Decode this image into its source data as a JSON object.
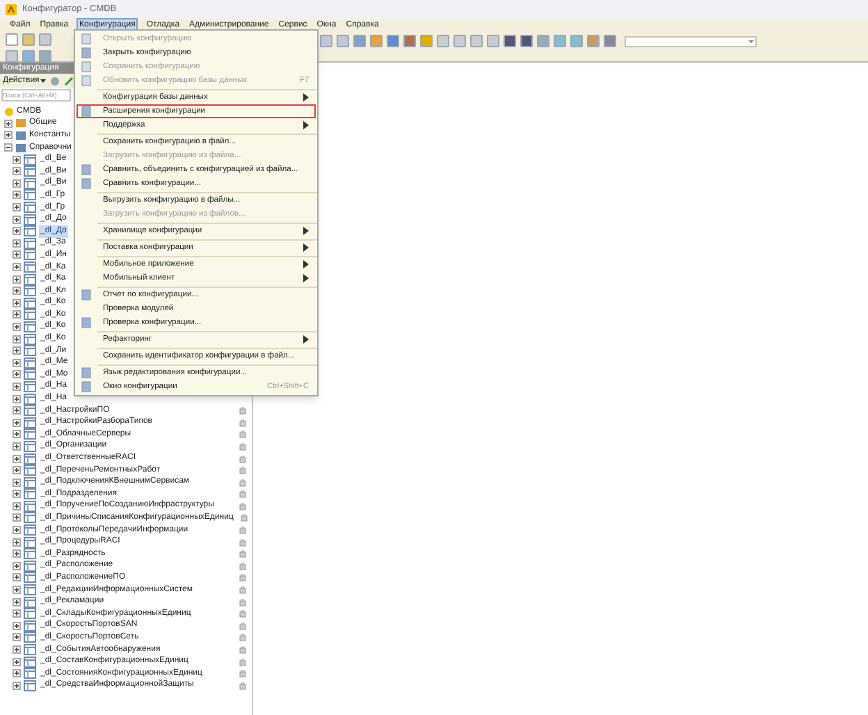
{
  "window": {
    "title": "Конфигуратор - CMDB"
  },
  "menubar": [
    {
      "label": "Файл",
      "selected": false
    },
    {
      "label": "Правка",
      "selected": false
    },
    {
      "label": "Конфигурация",
      "selected": true
    },
    {
      "label": "Отладка",
      "selected": false
    },
    {
      "label": "Администрирование",
      "selected": false
    },
    {
      "label": "Сервис",
      "selected": false
    },
    {
      "label": "Окна",
      "selected": false
    },
    {
      "label": "Справка",
      "selected": false
    }
  ],
  "menu": [
    {
      "kind": "item",
      "label": "Открыть конфигурацию",
      "disabled": true,
      "icon": true
    },
    {
      "kind": "item",
      "label": "Закрыть конфигурацию",
      "disabled": false,
      "icon": true
    },
    {
      "kind": "item",
      "label": "Сохранить конфигурацию",
      "disabled": true,
      "icon": true
    },
    {
      "kind": "item",
      "label": "Обновить конфигурацию базы данных",
      "disabled": true,
      "icon": true,
      "shortcut": "F7"
    },
    {
      "kind": "separator"
    },
    {
      "kind": "item",
      "label": "Конфигурация базы данных",
      "disabled": false,
      "submenu": true
    },
    {
      "kind": "item",
      "label": "Расширения конфигурации",
      "disabled": false,
      "icon": true,
      "outlined": true
    },
    {
      "kind": "item",
      "label": "Поддержка",
      "disabled": false,
      "submenu": true
    },
    {
      "kind": "separator"
    },
    {
      "kind": "item",
      "label": "Сохранить конфигурацию в файл...",
      "disabled": false
    },
    {
      "kind": "item",
      "label": "Загрузить конфигурацию из файла...",
      "disabled": true
    },
    {
      "kind": "item",
      "label": "Сравнить, объединить с конфигурацией из файла...",
      "disabled": false,
      "icon": true
    },
    {
      "kind": "item",
      "label": "Сравнить конфигурации...",
      "disabled": false,
      "icon": true
    },
    {
      "kind": "separator"
    },
    {
      "kind": "item",
      "label": "Выгрузить конфигурацию в файлы...",
      "disabled": false
    },
    {
      "kind": "item",
      "label": "Загрузить конфигурацию из файлов...",
      "disabled": true
    },
    {
      "kind": "separator"
    },
    {
      "kind": "item",
      "label": "Хранилище конфигурации",
      "disabled": false,
      "submenu": true
    },
    {
      "kind": "separator"
    },
    {
      "kind": "item",
      "label": "Поставка конфигурации",
      "disabled": false,
      "submenu": true
    },
    {
      "kind": "separator"
    },
    {
      "kind": "item",
      "label": "Мобильное приложение",
      "disabled": false,
      "submenu": true
    },
    {
      "kind": "item",
      "label": "Мобильный клиент",
      "disabled": false,
      "submenu": true
    },
    {
      "kind": "separator"
    },
    {
      "kind": "item",
      "label": "Отчет по конфигурации...",
      "disabled": false,
      "icon": true
    },
    {
      "kind": "item",
      "label": "Проверка модулей",
      "disabled": false
    },
    {
      "kind": "item",
      "label": "Проверка конфигурации...",
      "disabled": false,
      "icon": true
    },
    {
      "kind": "separator"
    },
    {
      "kind": "item",
      "label": "Рефакторинг",
      "disabled": false,
      "submenu": true
    },
    {
      "kind": "separator"
    },
    {
      "kind": "item",
      "label": "Сохранить идентификатор конфигурации в файл...",
      "disabled": false
    },
    {
      "kind": "separator"
    },
    {
      "kind": "item",
      "label": "Язык редактирования конфигурации...",
      "disabled": false,
      "icon": true
    },
    {
      "kind": "item",
      "label": "Окно конфигурации",
      "disabled": false,
      "icon": true,
      "shortcut": "Ctrl+Shift+C"
    }
  ],
  "panel": {
    "title": "Конфигурация",
    "actions": "Действия",
    "search": {
      "placeholder": "Поиск (Ctrl+Alt+M)"
    }
  },
  "tree": {
    "label": "CMDB",
    "children": [
      {
        "label": "Общие",
        "expanded": false
      },
      {
        "label": "Константы",
        "expanded": false
      },
      {
        "label": "Справочни",
        "expanded": true,
        "children": [
          {
            "label": "_dl_Ве",
            "selected": false,
            "mark": false
          },
          {
            "label": "_dl_Ви",
            "selected": false,
            "mark": false
          },
          {
            "label": "_dl_Ви",
            "selected": false,
            "mark": false
          },
          {
            "label": "_dl_Гр",
            "selected": false,
            "mark": false
          },
          {
            "label": "_dl_Гр",
            "selected": false,
            "mark": false
          },
          {
            "label": "_dl_До",
            "selected": false,
            "mark": false
          },
          {
            "label": "_dl_До",
            "selected": true,
            "mark": false
          },
          {
            "label": "_dl_За",
            "selected": false,
            "mark": false
          },
          {
            "label": "_dl_Ин",
            "selected": false,
            "mark": false
          },
          {
            "label": "_dl_Ка",
            "selected": false,
            "mark": false
          },
          {
            "label": "_dl_Ка",
            "selected": false,
            "mark": false
          },
          {
            "label": "_dl_Кл",
            "selected": false,
            "mark": false
          },
          {
            "label": "_dl_Ко",
            "selected": false,
            "mark": false
          },
          {
            "label": "_dl_Ко",
            "selected": false,
            "mark": false
          },
          {
            "label": "_dl_Ко",
            "selected": false,
            "mark": false
          },
          {
            "label": "_dl_Ко",
            "selected": false,
            "mark": false
          },
          {
            "label": "_dl_Ли",
            "selected": false,
            "mark": false
          },
          {
            "label": "_dl_Ме",
            "selected": false,
            "mark": false
          },
          {
            "label": "_dl_Мо",
            "selected": false,
            "mark": false
          },
          {
            "label": "_dl_На",
            "selected": false,
            "mark": false
          },
          {
            "label": "_dl_На",
            "selected": false,
            "mark": false
          },
          {
            "label": "_dl_НастройкиПО",
            "selected": false,
            "mark": true
          },
          {
            "label": "_dl_НастройкиРазбораТипов",
            "selected": false,
            "mark": true
          },
          {
            "label": "_dl_ОблачныеСерверы",
            "selected": false,
            "mark": true
          },
          {
            "label": "_dl_Организации",
            "selected": false,
            "mark": true
          },
          {
            "label": "_dl_ОтветственныеRACI",
            "selected": false,
            "mark": true
          },
          {
            "label": "_dl_ПереченьРемонтныхРабот",
            "selected": false,
            "mark": true
          },
          {
            "label": "_dl_ПодключенияКВнешнимСервисам",
            "selected": false,
            "mark": true
          },
          {
            "label": "_dl_Подразделения",
            "selected": false,
            "mark": true
          },
          {
            "label": "_dl_ПоручениеПоСозданиюИнфраструктуры",
            "selected": false,
            "mark": true
          },
          {
            "label": "_dl_ПричиныСписанияКонфигурационныхЕдиниц",
            "selected": false,
            "mark": true
          },
          {
            "label": "_dl_ПротоколыПередачиИнформации",
            "selected": false,
            "mark": true
          },
          {
            "label": "_dl_ПроцедурыRACI",
            "selected": false,
            "mark": true
          },
          {
            "label": "_dl_Разрядность",
            "selected": false,
            "mark": true
          },
          {
            "label": "_dl_Расположение",
            "selected": false,
            "mark": true
          },
          {
            "label": "_dl_РасположениеПО",
            "selected": false,
            "mark": true
          },
          {
            "label": "_dl_РедакцииИнформационныхСистем",
            "selected": false,
            "mark": true
          },
          {
            "label": "_dl_Рекламации",
            "selected": false,
            "mark": true
          },
          {
            "label": "_dl_СкладыКонфигурационныхЕдиниц",
            "selected": false,
            "mark": true
          },
          {
            "label": "_dl_СкоростьПортовSAN",
            "selected": false,
            "mark": true
          },
          {
            "label": "_dl_СкоростьПортовСеть",
            "selected": false,
            "mark": true
          },
          {
            "label": "_dl_СобытияАвтообнаружения",
            "selected": false,
            "mark": true
          },
          {
            "label": "_dl_СоставКонфигурационныхЕдиниц",
            "selected": false,
            "mark": true
          },
          {
            "label": "_dl_СостоянияКонфигурационныхЕдиниц",
            "selected": false,
            "mark": true
          },
          {
            "label": "_dl_СредстваИнформационнойЗащиты",
            "selected": false,
            "mark": true
          }
        ]
      }
    ]
  }
}
